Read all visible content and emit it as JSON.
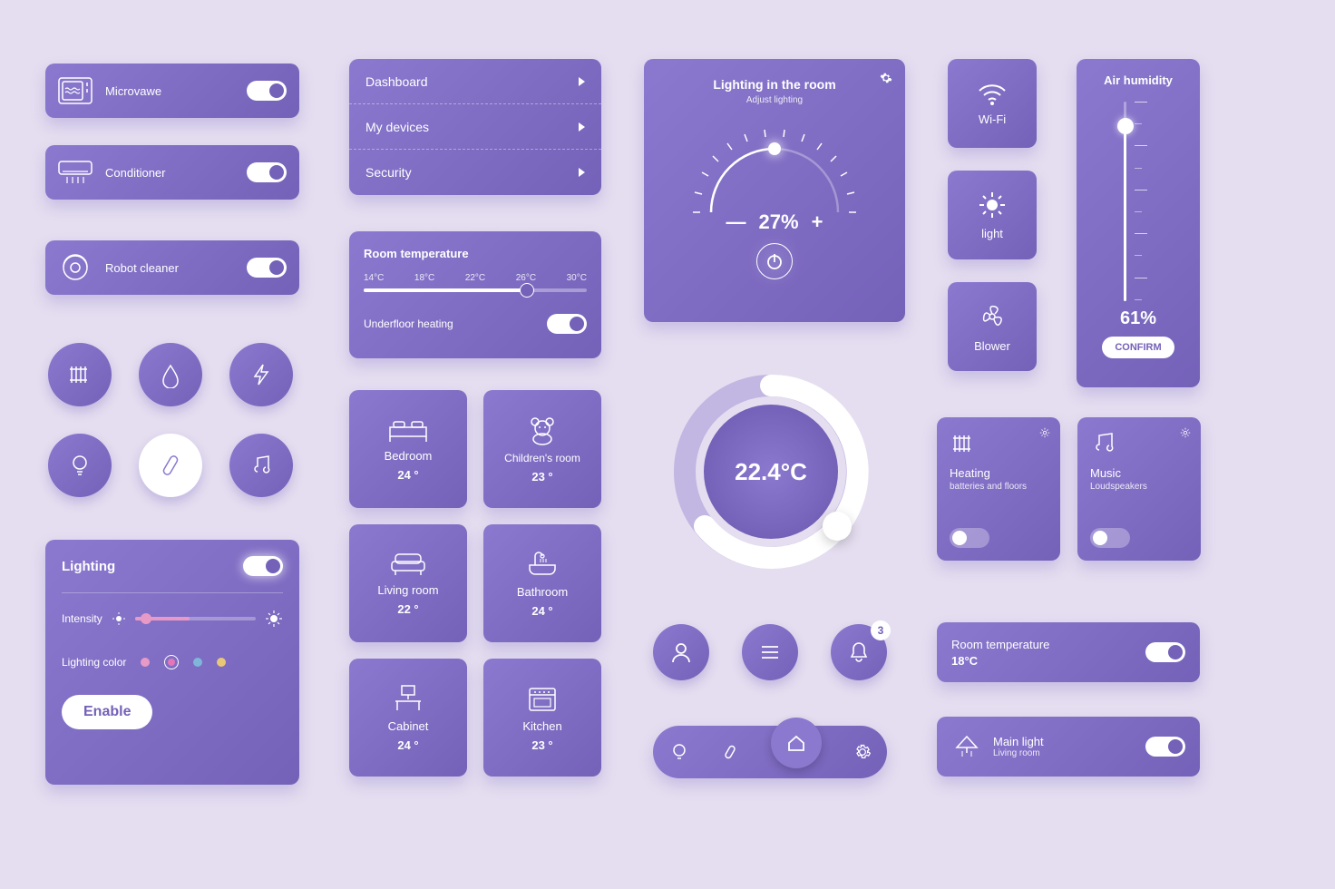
{
  "devices": {
    "microwave": "Microvawe",
    "conditioner": "Conditioner",
    "robot": "Robot cleaner"
  },
  "menu": {
    "items": [
      "Dashboard",
      "My devices",
      "Security"
    ]
  },
  "roomtemp": {
    "title": "Room temperature",
    "ticks": [
      "14°C",
      "18°C",
      "22°C",
      "26°C",
      "30°C"
    ],
    "heating": "Underfloor heating"
  },
  "lighting_card": {
    "title": "Lighting",
    "intensity": "Intensity",
    "color": "Lighting color",
    "enable": "Enable"
  },
  "rooms": {
    "bedroom": {
      "label": "Bedroom",
      "temp": "24 °"
    },
    "children": {
      "label": "Children's room",
      "temp": "23 °"
    },
    "living": {
      "label": "Living room",
      "temp": "22 °"
    },
    "bathroom": {
      "label": "Bathroom",
      "temp": "24 °"
    },
    "cabinet": {
      "label": "Cabinet",
      "temp": "24 °"
    },
    "kitchen": {
      "label": "Kitchen",
      "temp": "23 °"
    }
  },
  "dial": {
    "title": "Lighting in the room",
    "sub": "Adjust lighting",
    "value": "27%",
    "minus": "—",
    "plus": "+"
  },
  "ring": {
    "value": "22.4°C"
  },
  "nav_badge": "3",
  "tiles": {
    "wifi": "Wi-Fi",
    "light": "light",
    "blower": "Blower"
  },
  "heating_tile": {
    "title": "Heating",
    "sub": "batteries and floors"
  },
  "music_tile": {
    "title": "Music",
    "sub": "Loudspeakers"
  },
  "humidity": {
    "title": "Air humidity",
    "value": "61%",
    "confirm": "CONFIRM"
  },
  "roomtemp_bar": {
    "label": "Room temperature",
    "value": "18°C"
  },
  "mainlight": {
    "label": "Main light",
    "sub": "Living room"
  }
}
